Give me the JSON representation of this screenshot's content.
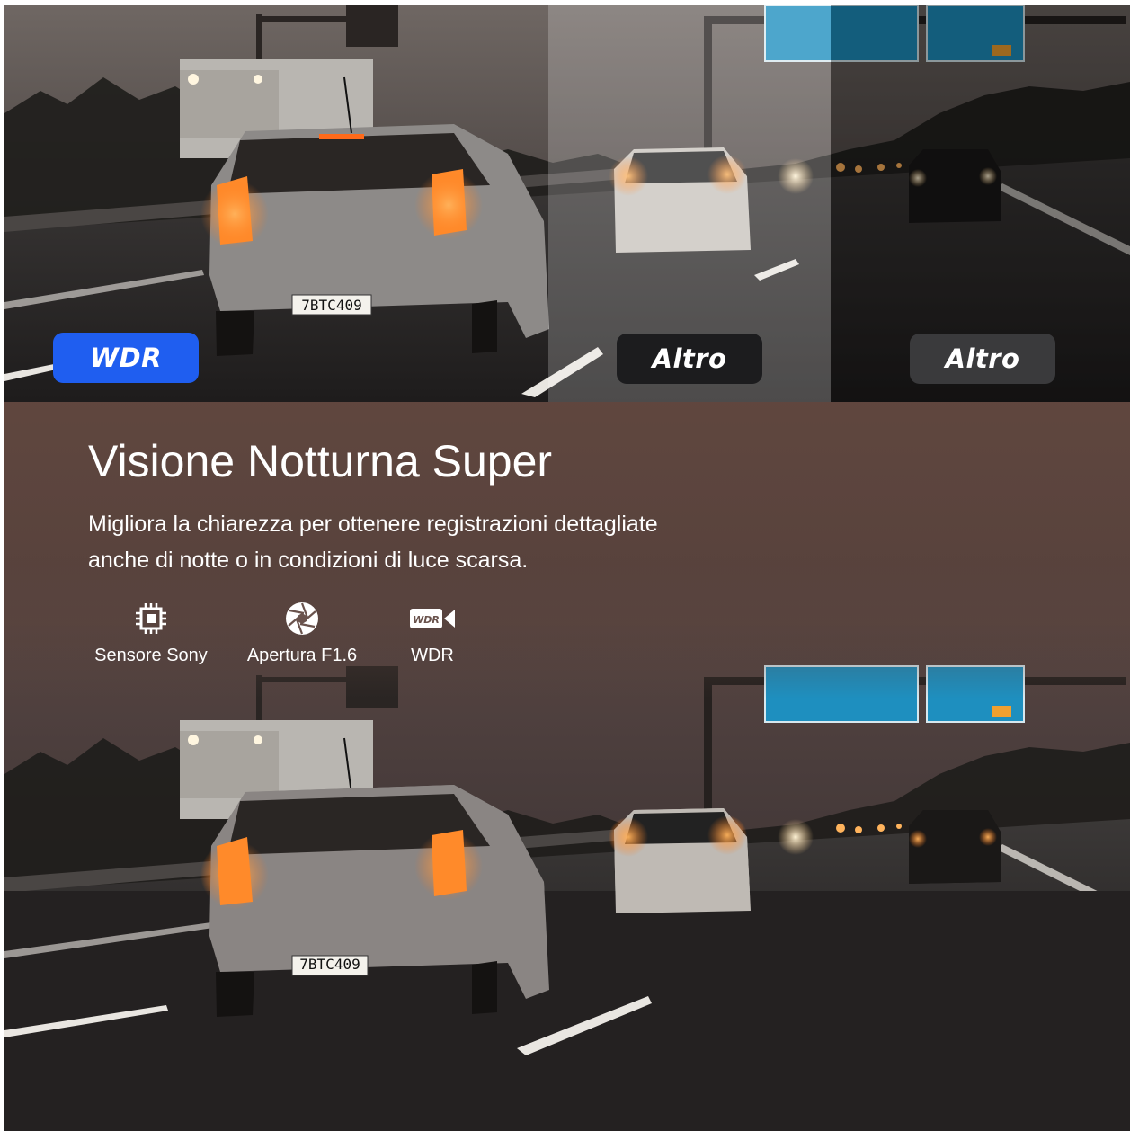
{
  "comparison": {
    "badges": [
      {
        "label": "WDR",
        "color": "#1f5ef0"
      },
      {
        "label": "Altro",
        "color": "#1c1c1e"
      },
      {
        "label": "Altro",
        "color": "#3a3a3c"
      }
    ],
    "plates": [
      "7BTC409",
      "7BTC409"
    ]
  },
  "feature_section": {
    "title": "Visione Notturna Super",
    "description_lines": [
      "Migliora la chiarezza per ottenere registrazioni dettagliate",
      "anche di notte o in condizioni di luce scarsa."
    ],
    "features": [
      {
        "icon": "chip-icon",
        "label": "Sensore Sony"
      },
      {
        "icon": "aperture-icon",
        "label": "Apertura F1.6"
      },
      {
        "icon": "wdr-camera-icon",
        "label": "WDR",
        "icon_text": "WDR"
      }
    ]
  }
}
